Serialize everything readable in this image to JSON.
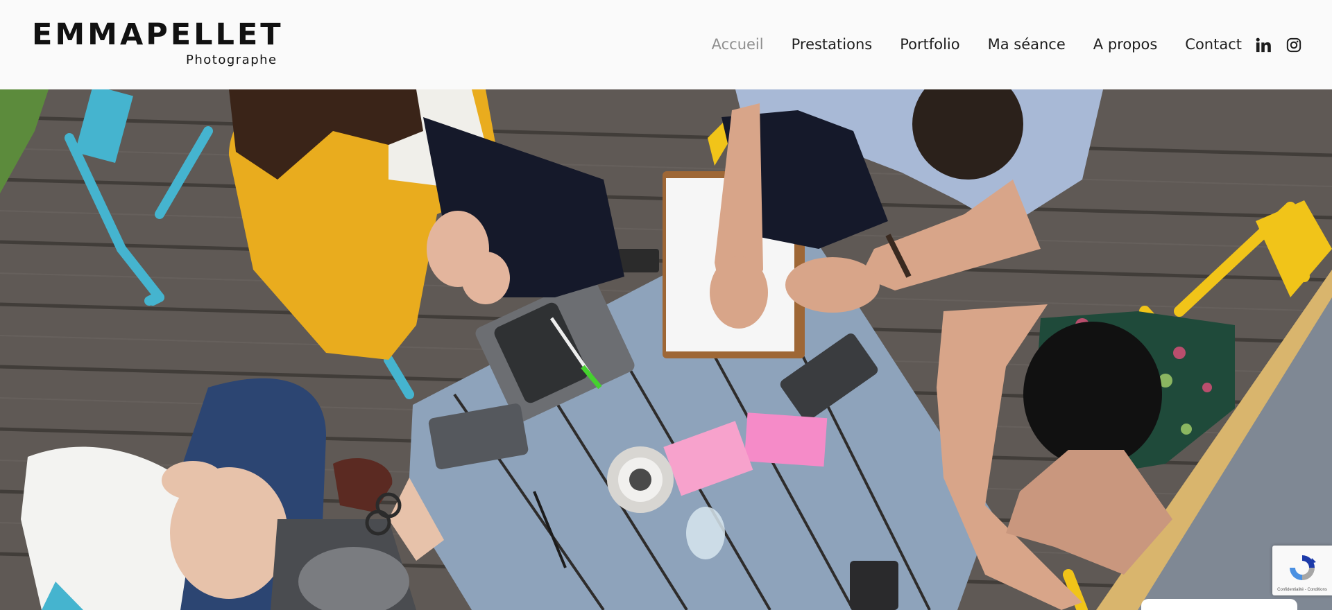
{
  "brand": {
    "name": "EMMAPELLET",
    "tagline": "Photographe"
  },
  "nav": {
    "items": [
      {
        "label": "Accueil",
        "active": true
      },
      {
        "label": "Prestations",
        "active": false
      },
      {
        "label": "Portfolio",
        "active": false
      },
      {
        "label": "Ma séance",
        "active": false
      },
      {
        "label": "A propos",
        "active": false
      },
      {
        "label": "Contact",
        "active": false
      }
    ]
  },
  "social": {
    "icons": [
      "linkedin-icon",
      "instagram-icon"
    ]
  },
  "hero": {
    "image_subject": "overhead view of four people in a meeting around a blue outdoor table on a wooden deck"
  },
  "recaptcha": {
    "terms": "Confidentialité - Conditions"
  },
  "colors": {
    "header_bg": "#fafafa",
    "nav_text": "#1d1d1d",
    "nav_active": "#8e8e8e",
    "deck": "#5f5955",
    "table": "#8ea3bb",
    "jacket_yellow": "#e9ac1e",
    "chair_blue": "#45b4cf",
    "chair_yellow": "#f1c419",
    "sticky_pink": "#f58bc8"
  }
}
